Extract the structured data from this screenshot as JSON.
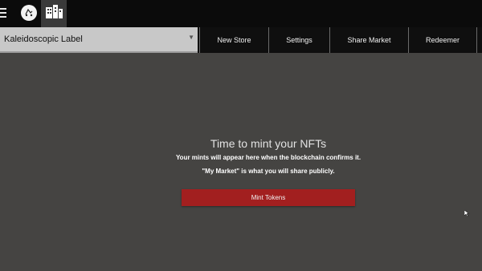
{
  "header": {
    "menu_icon": "hamburger-icon",
    "logo_icon": "store-logo-icon",
    "stores_icon": "building-icon"
  },
  "navbar": {
    "store_select_value": "Kaleidoscopic Label",
    "items": [
      {
        "label": "New Store"
      },
      {
        "label": "Settings"
      },
      {
        "label": "Share Market"
      },
      {
        "label": "Redeemer"
      }
    ]
  },
  "main": {
    "title": "Time to mint your NFTs",
    "line1": "Your mints will appear here when the blockchain confirms it.",
    "line2": "\"My Market\" is what you will share publicly.",
    "mint_button": "Mint Tokens"
  },
  "colors": {
    "accent": "#a21f1f",
    "background": "#454442",
    "topbar": "#0b0b0b"
  }
}
